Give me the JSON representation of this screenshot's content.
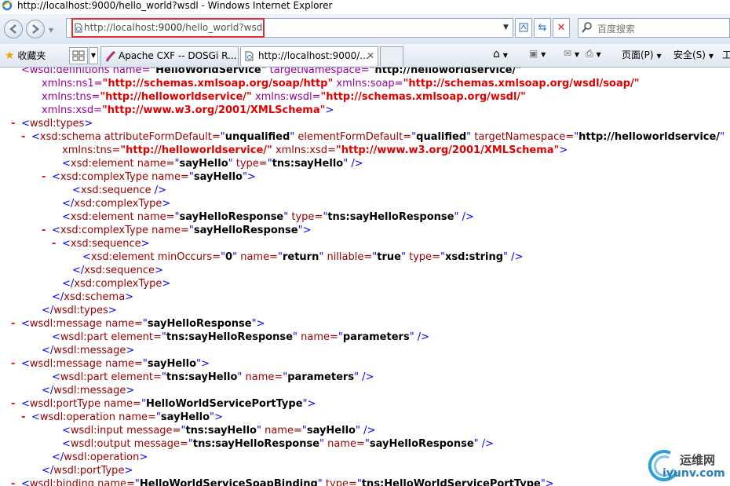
{
  "window": {
    "title": "http://localhost:9000/hello_world?wsdl - Windows Internet Explorer"
  },
  "addressbar": {
    "url_host": "http://localhost",
    "url_port": ":9000",
    "url_path": "/hello_world?wsdl"
  },
  "search": {
    "placeholder": "百度搜索"
  },
  "favorites": {
    "label": "收藏夹"
  },
  "tabs": [
    {
      "label": "Apache CXF -- DOSGi R..."
    },
    {
      "label": "http://localhost:9000/..."
    }
  ],
  "commands": {
    "page": "页面(P)",
    "safety": "安全(S)",
    "tools": "工"
  },
  "wsdl_lines": [
    {
      "indent": 1,
      "minus": "",
      "parts": [
        [
          "t",
          "<wsdl:definitions name="
        ],
        [
          "vb",
          "\"HelloWorldService\""
        ],
        [
          "t",
          " targetNamespace="
        ],
        [
          "vb",
          "\"http://helloworldservice/\""
        ]
      ]
    },
    {
      "indent": 3,
      "minus": "",
      "parts": [
        [
          "t",
          "xmlns:ns1="
        ],
        [
          "vr",
          "\"http://schemas.xmlsoap.org/soap/http\""
        ],
        [
          "t",
          " xmlns:soap="
        ],
        [
          "vr",
          "\"http://schemas.xmlsoap.org/wsdl/soap/\""
        ]
      ]
    },
    {
      "indent": 3,
      "minus": "",
      "parts": [
        [
          "t",
          "xmlns:tns="
        ],
        [
          "vr",
          "\"http://helloworldservice/\""
        ],
        [
          "t",
          " xmlns:wsdl="
        ],
        [
          "vr",
          "\"http://schemas.xmlsoap.org/wsdl/\""
        ]
      ]
    },
    {
      "indent": 3,
      "minus": "",
      "parts": [
        [
          "t",
          "xmlns:xsd="
        ],
        [
          "vr",
          "\"http://www.w3.org/2001/XMLSchema\""
        ],
        [
          "bl",
          ">"
        ]
      ]
    },
    {
      "indent": 1,
      "minus": "-",
      "parts": [
        [
          "bl",
          "<"
        ],
        [
          "tn",
          "wsdl:types"
        ],
        [
          "bl",
          ">"
        ]
      ]
    },
    {
      "indent": 2,
      "minus": "-",
      "parts": [
        [
          "bl",
          "<"
        ],
        [
          "tn",
          "xsd:schema"
        ],
        [
          "tn",
          " attributeFormDefault="
        ],
        [
          "bl",
          "\""
        ],
        [
          "vb",
          "unqualified"
        ],
        [
          "bl",
          "\""
        ],
        [
          "tn",
          " elementFormDefault="
        ],
        [
          "bl",
          "\""
        ],
        [
          "vb",
          "qualified"
        ],
        [
          "bl",
          "\""
        ],
        [
          "tn",
          " targetNamespace="
        ],
        [
          "bl",
          "\""
        ],
        [
          "vb",
          "http://helloworldservice/"
        ],
        [
          "bl",
          "\""
        ]
      ]
    },
    {
      "indent": 5,
      "minus": "",
      "parts": [
        [
          "tn",
          "xmlns:tns="
        ],
        [
          "vr",
          "\"http://helloworldservice/\""
        ],
        [
          "tn",
          " xmlns:xsd="
        ],
        [
          "vr",
          "\"http://www.w3.org/2001/XMLSchema\""
        ],
        [
          "bl",
          ">"
        ]
      ]
    },
    {
      "indent": 5,
      "minus": "",
      "parts": [
        [
          "bl",
          "<"
        ],
        [
          "tn",
          "xsd:element"
        ],
        [
          "tn",
          " name="
        ],
        [
          "bl",
          "\""
        ],
        [
          "vb",
          "sayHello"
        ],
        [
          "bl",
          "\""
        ],
        [
          "tn",
          " type="
        ],
        [
          "bl",
          "\""
        ],
        [
          "vb",
          "tns:sayHello"
        ],
        [
          "bl",
          "\" />"
        ]
      ]
    },
    {
      "indent": 4,
      "minus": "-",
      "parts": [
        [
          "bl",
          "<"
        ],
        [
          "tn",
          "xsd:complexType"
        ],
        [
          "tn",
          " name="
        ],
        [
          "bl",
          "\""
        ],
        [
          "vb",
          "sayHello"
        ],
        [
          "bl",
          "\">"
        ]
      ]
    },
    {
      "indent": 6,
      "minus": "",
      "parts": [
        [
          "bl",
          "<"
        ],
        [
          "tn",
          "xsd:sequence"
        ],
        [
          "bl",
          " />"
        ]
      ]
    },
    {
      "indent": 5,
      "minus": "",
      "parts": [
        [
          "bl",
          "</"
        ],
        [
          "tn",
          "xsd:complexType"
        ],
        [
          "bl",
          ">"
        ]
      ]
    },
    {
      "indent": 5,
      "minus": "",
      "parts": [
        [
          "bl",
          "<"
        ],
        [
          "tn",
          "xsd:element"
        ],
        [
          "tn",
          " name="
        ],
        [
          "bl",
          "\""
        ],
        [
          "vb",
          "sayHelloResponse"
        ],
        [
          "bl",
          "\""
        ],
        [
          "tn",
          " type="
        ],
        [
          "bl",
          "\""
        ],
        [
          "vb",
          "tns:sayHelloResponse"
        ],
        [
          "bl",
          "\" />"
        ]
      ]
    },
    {
      "indent": 4,
      "minus": "-",
      "parts": [
        [
          "bl",
          "<"
        ],
        [
          "tn",
          "xsd:complexType"
        ],
        [
          "tn",
          " name="
        ],
        [
          "bl",
          "\""
        ],
        [
          "vb",
          "sayHelloResponse"
        ],
        [
          "bl",
          "\">"
        ]
      ]
    },
    {
      "indent": 5,
      "minus": "-",
      "parts": [
        [
          "bl",
          "<"
        ],
        [
          "tn",
          "xsd:sequence"
        ],
        [
          "bl",
          ">"
        ]
      ]
    },
    {
      "indent": 7,
      "minus": "",
      "parts": [
        [
          "bl",
          "<"
        ],
        [
          "tn",
          "xsd:element"
        ],
        [
          "tn",
          " minOccurs="
        ],
        [
          "bl",
          "\""
        ],
        [
          "vb",
          "0"
        ],
        [
          "bl",
          "\""
        ],
        [
          "tn",
          " name="
        ],
        [
          "bl",
          "\""
        ],
        [
          "vb",
          "return"
        ],
        [
          "bl",
          "\""
        ],
        [
          "tn",
          " nillable="
        ],
        [
          "bl",
          "\""
        ],
        [
          "vb",
          "true"
        ],
        [
          "bl",
          "\""
        ],
        [
          "tn",
          " type="
        ],
        [
          "bl",
          "\""
        ],
        [
          "vb",
          "xsd:string"
        ],
        [
          "bl",
          "\" />"
        ]
      ]
    },
    {
      "indent": 6,
      "minus": "",
      "parts": [
        [
          "bl",
          "</"
        ],
        [
          "tn",
          "xsd:sequence"
        ],
        [
          "bl",
          ">"
        ]
      ]
    },
    {
      "indent": 5,
      "minus": "",
      "parts": [
        [
          "bl",
          "</"
        ],
        [
          "tn",
          "xsd:complexType"
        ],
        [
          "bl",
          ">"
        ]
      ]
    },
    {
      "indent": 4,
      "minus": "",
      "parts": [
        [
          "bl",
          "</"
        ],
        [
          "tn",
          "xsd:schema"
        ],
        [
          "bl",
          ">"
        ]
      ]
    },
    {
      "indent": 3,
      "minus": "",
      "parts": [
        [
          "bl",
          "</"
        ],
        [
          "tn",
          "wsdl:types"
        ],
        [
          "bl",
          ">"
        ]
      ]
    },
    {
      "indent": 1,
      "minus": "-",
      "parts": [
        [
          "bl",
          "<"
        ],
        [
          "tn",
          "wsdl:message"
        ],
        [
          "tn",
          " name="
        ],
        [
          "bl",
          "\""
        ],
        [
          "vb",
          "sayHelloResponse"
        ],
        [
          "bl",
          "\">"
        ]
      ]
    },
    {
      "indent": 4,
      "minus": "",
      "parts": [
        [
          "bl",
          "<"
        ],
        [
          "tn",
          "wsdl:part"
        ],
        [
          "tn",
          " element="
        ],
        [
          "bl",
          "\""
        ],
        [
          "vb",
          "tns:sayHelloResponse"
        ],
        [
          "bl",
          "\""
        ],
        [
          "tn",
          " name="
        ],
        [
          "bl",
          "\""
        ],
        [
          "vb",
          "parameters"
        ],
        [
          "bl",
          "\" />"
        ]
      ]
    },
    {
      "indent": 3,
      "minus": "",
      "parts": [
        [
          "bl",
          "</"
        ],
        [
          "tn",
          "wsdl:message"
        ],
        [
          "bl",
          ">"
        ]
      ]
    },
    {
      "indent": 1,
      "minus": "-",
      "parts": [
        [
          "bl",
          "<"
        ],
        [
          "tn",
          "wsdl:message"
        ],
        [
          "tn",
          " name="
        ],
        [
          "bl",
          "\""
        ],
        [
          "vb",
          "sayHello"
        ],
        [
          "bl",
          "\">"
        ]
      ]
    },
    {
      "indent": 4,
      "minus": "",
      "parts": [
        [
          "bl",
          "<"
        ],
        [
          "tn",
          "wsdl:part"
        ],
        [
          "tn",
          " element="
        ],
        [
          "bl",
          "\""
        ],
        [
          "vb",
          "tns:sayHello"
        ],
        [
          "bl",
          "\""
        ],
        [
          "tn",
          " name="
        ],
        [
          "bl",
          "\""
        ],
        [
          "vb",
          "parameters"
        ],
        [
          "bl",
          "\" />"
        ]
      ]
    },
    {
      "indent": 3,
      "minus": "",
      "parts": [
        [
          "bl",
          "</"
        ],
        [
          "tn",
          "wsdl:message"
        ],
        [
          "bl",
          ">"
        ]
      ]
    },
    {
      "indent": 1,
      "minus": "-",
      "parts": [
        [
          "bl",
          "<"
        ],
        [
          "tn",
          "wsdl:portType"
        ],
        [
          "tn",
          " name="
        ],
        [
          "bl",
          "\""
        ],
        [
          "vb",
          "HelloWorldServicePortType"
        ],
        [
          "bl",
          "\">"
        ]
      ]
    },
    {
      "indent": 2,
      "minus": "-",
      "parts": [
        [
          "bl",
          "<"
        ],
        [
          "tn",
          "wsdl:operation"
        ],
        [
          "tn",
          " name="
        ],
        [
          "bl",
          "\""
        ],
        [
          "vb",
          "sayHello"
        ],
        [
          "bl",
          "\">"
        ]
      ]
    },
    {
      "indent": 5,
      "minus": "",
      "parts": [
        [
          "bl",
          "<"
        ],
        [
          "tn",
          "wsdl:input"
        ],
        [
          "tn",
          " message="
        ],
        [
          "bl",
          "\""
        ],
        [
          "vb",
          "tns:sayHello"
        ],
        [
          "bl",
          "\""
        ],
        [
          "tn",
          " name="
        ],
        [
          "bl",
          "\""
        ],
        [
          "vb",
          "sayHello"
        ],
        [
          "bl",
          "\" />"
        ]
      ]
    },
    {
      "indent": 5,
      "minus": "",
      "parts": [
        [
          "bl",
          "<"
        ],
        [
          "tn",
          "wsdl:output"
        ],
        [
          "tn",
          " message="
        ],
        [
          "bl",
          "\""
        ],
        [
          "vb",
          "tns:sayHelloResponse"
        ],
        [
          "bl",
          "\""
        ],
        [
          "tn",
          " name="
        ],
        [
          "bl",
          "\""
        ],
        [
          "vb",
          "sayHelloResponse"
        ],
        [
          "bl",
          "\" />"
        ]
      ]
    },
    {
      "indent": 4,
      "minus": "",
      "parts": [
        [
          "bl",
          "</"
        ],
        [
          "tn",
          "wsdl:operation"
        ],
        [
          "bl",
          ">"
        ]
      ]
    },
    {
      "indent": 3,
      "minus": "",
      "parts": [
        [
          "bl",
          "</"
        ],
        [
          "tn",
          "wsdl:portType"
        ],
        [
          "bl",
          ">"
        ]
      ]
    },
    {
      "indent": 1,
      "minus": "-",
      "parts": [
        [
          "bl",
          "<"
        ],
        [
          "tn",
          "wsdl:binding"
        ],
        [
          "tn",
          " name="
        ],
        [
          "bl",
          "\""
        ],
        [
          "vb",
          "HelloWorldServiceSoapBinding"
        ],
        [
          "bl",
          "\""
        ],
        [
          "tn",
          " type="
        ],
        [
          "bl",
          "\""
        ],
        [
          "vb",
          "tns:HelloWorldServicePortType"
        ],
        [
          "bl",
          "\">"
        ]
      ]
    }
  ],
  "watermark": {
    "line1": "运维网",
    "line2": "iyunv.com"
  }
}
